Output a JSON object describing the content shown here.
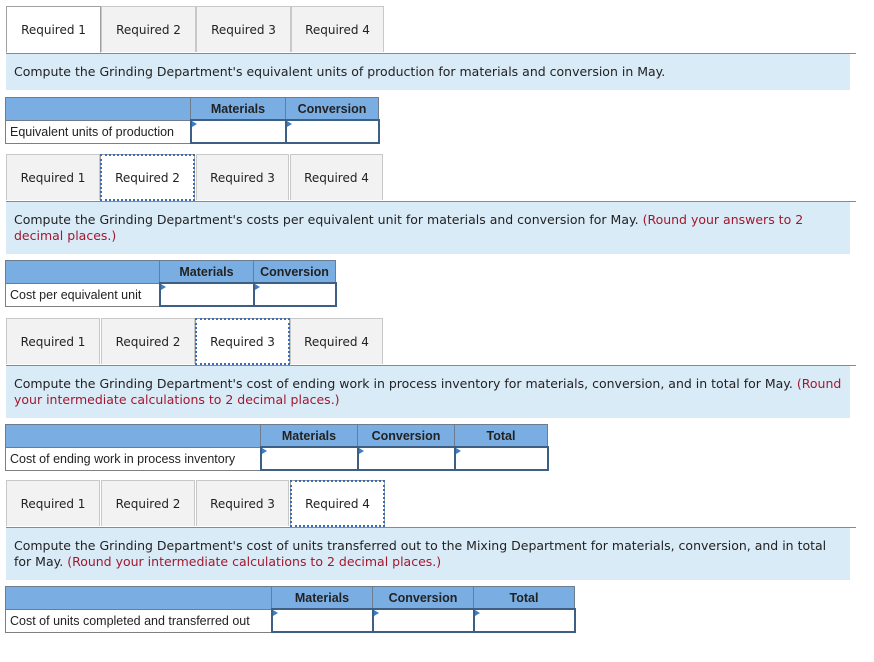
{
  "tabs": [
    "Required 1",
    "Required 2",
    "Required 3",
    "Required 4"
  ],
  "parts": [
    {
      "active_tab": 0,
      "prompt": "Compute the Grinding Department's equivalent units of production for materials and conversion in May.",
      "note": "",
      "columns": [
        "Materials",
        "Conversion"
      ],
      "row_label": "Equivalent units of production",
      "values": [
        "",
        ""
      ]
    },
    {
      "active_tab": 1,
      "prompt": "Compute the Grinding Department's costs per equivalent unit for materials and conversion for May.",
      "note": "(Round your answers to 2 decimal places.)",
      "columns": [
        "Materials",
        "Conversion"
      ],
      "row_label": "Cost per equivalent unit",
      "values": [
        "",
        ""
      ]
    },
    {
      "active_tab": 2,
      "prompt": "Compute the Grinding Department's cost of ending work in process inventory for materials, conversion, and in total for May.",
      "note": "(Round your intermediate calculations to 2 decimal places.)",
      "columns": [
        "Materials",
        "Conversion",
        "Total"
      ],
      "row_label": "Cost of ending work in process inventory",
      "values": [
        "",
        "",
        ""
      ]
    },
    {
      "active_tab": 3,
      "prompt": "Compute the Grinding Department's cost of units transferred out to the Mixing Department for materials, conversion, and in total for May.",
      "note": "(Round your intermediate calculations to 2 decimal places.)",
      "columns": [
        "Materials",
        "Conversion",
        "Total"
      ],
      "row_label": "Cost of units completed and transferred out",
      "values": [
        "",
        "",
        ""
      ]
    }
  ]
}
